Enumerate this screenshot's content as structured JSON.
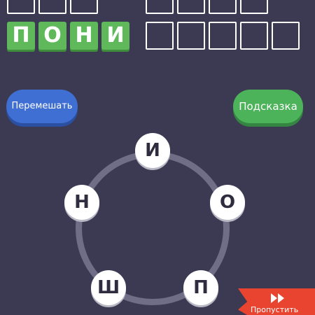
{
  "solved_word": [
    "П",
    "О",
    "Н",
    "И"
  ],
  "buttons": {
    "shuffle_label": "Перемешать",
    "hint_label": "Подсказка",
    "skip_label": "Пропустить"
  },
  "wheel_letters": [
    "И",
    "О",
    "П",
    "Ш",
    "Н"
  ],
  "colors": {
    "background": "#3c3a52",
    "solved_tile": "#5fb85a",
    "shuffle_button": "#3f6fd3",
    "hint_button": "#4cb35a",
    "skip_ribbon": "#e8442f",
    "wheel_ring": "#706d87"
  },
  "icons": {
    "skip": "fast-forward-icon"
  }
}
